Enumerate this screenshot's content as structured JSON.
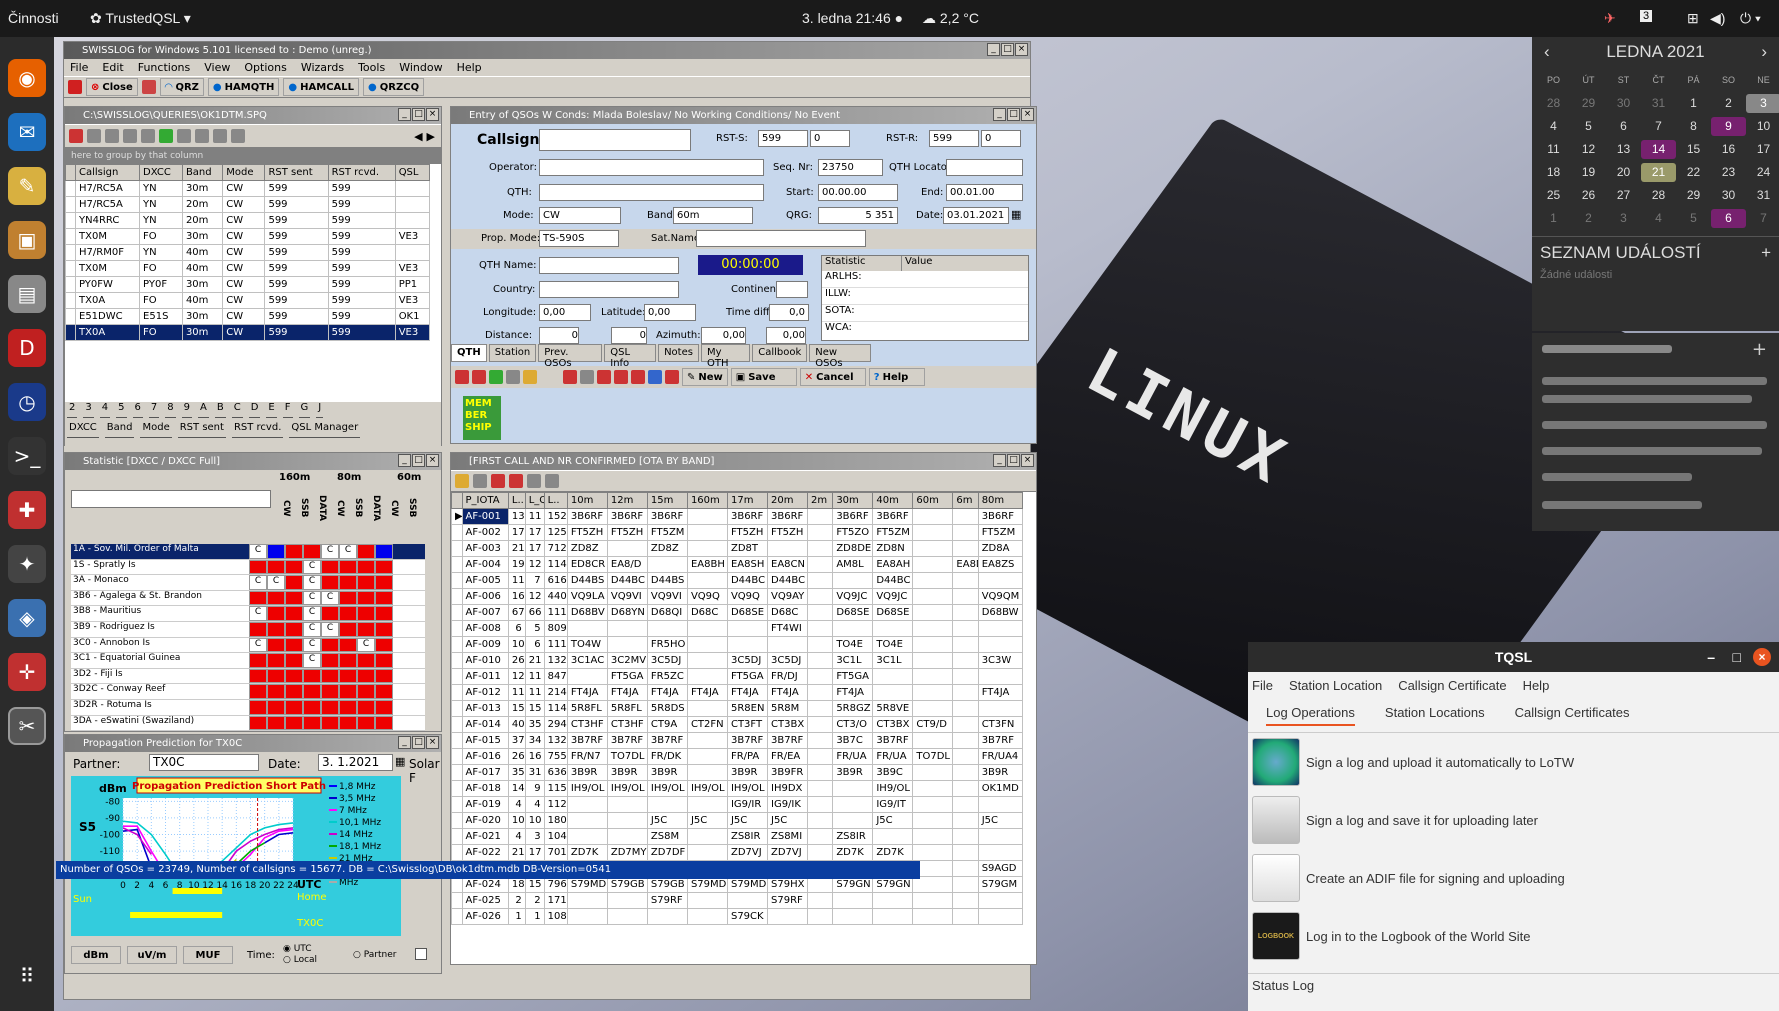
{
  "topbar": {
    "activities": "Činnosti",
    "app": "TrustedQSL",
    "clock": "3. ledna  21:46",
    "weather": "2,2 °C",
    "cal_badge": "3"
  },
  "swisslog": {
    "title": "SWISSLOG for Windows 5.101 licensed to : Demo (unreg.)",
    "menu": [
      "File",
      "Edit",
      "Functions",
      "View",
      "Options",
      "Wizards",
      "Tools",
      "Window",
      "Help"
    ],
    "toolbar": [
      "Close",
      "QRZ",
      "HAMQTH",
      "HAMCALL",
      "QRZCQ"
    ]
  },
  "queries": {
    "title": "C:\\SWISSLOG\\QUERIES\\OK1DTM.SPQ",
    "group_hint": "here to group by that column",
    "columns": [
      "Callsign",
      "DXCC",
      "Band",
      "Mode",
      "RST sent",
      "RST rcvd.",
      "QSL"
    ],
    "rows": [
      [
        "H7/RC5A",
        "YN",
        "30m",
        "CW",
        "599",
        "599",
        ""
      ],
      [
        "H7/RC5A",
        "YN",
        "20m",
        "CW",
        "599",
        "599",
        ""
      ],
      [
        "YN4RRC",
        "YN",
        "20m",
        "CW",
        "599",
        "599",
        ""
      ],
      [
        "TX0M",
        "FO",
        "30m",
        "CW",
        "599",
        "599",
        "VE3"
      ],
      [
        "H7/RM0F",
        "YN",
        "40m",
        "CW",
        "599",
        "599",
        ""
      ],
      [
        "TX0M",
        "FO",
        "40m",
        "CW",
        "599",
        "599",
        "VE3"
      ],
      [
        "PY0FW",
        "PY0F",
        "30m",
        "CW",
        "599",
        "599",
        "PP1"
      ],
      [
        "TX0A",
        "FO",
        "40m",
        "CW",
        "599",
        "599",
        "VE3"
      ],
      [
        "E51DWC",
        "E51S",
        "30m",
        "CW",
        "599",
        "599",
        "OK1"
      ],
      [
        "TX0A",
        "FO",
        "30m",
        "CW",
        "599",
        "599",
        "VE3"
      ]
    ],
    "tabs_top": [
      "2",
      "3",
      "4",
      "5",
      "6",
      "7",
      "8",
      "9",
      "A",
      "B",
      "C",
      "D",
      "E",
      "F",
      "G",
      "J"
    ],
    "tabs_bottom": [
      "DXCC",
      "Band",
      "Mode",
      "RST sent",
      "RST rcvd.",
      "QSL Manager"
    ]
  },
  "entry": {
    "title": "Entry of QSOs   W Conds: Mlada Boleslav/ No Working Conditions/ No Event",
    "labels": {
      "callsign": "Callsign:",
      "rsts": "RST-S:",
      "rstr": "RST-R:",
      "operator": "Operator:",
      "seq": "Seq. Nr:",
      "loc": "QTH Locator:",
      "qth": "QTH:",
      "start": "Start:",
      "end": "End:",
      "mode": "Mode:",
      "band": "Band:",
      "qrg": "QRG:",
      "date": "Date:",
      "prop": "Prop. Mode:",
      "sat": "Sat.Name:",
      "qthname": "QTH Name:",
      "country": "Country:",
      "continent": "Continent:",
      "lon": "Longitude:",
      "lat": "Latitude:",
      "timediff": "Time diff:",
      "distance": "Distance:",
      "azimuth": "Azimuth:"
    },
    "values": {
      "rsts": "599",
      "rsts2": "0",
      "rstr": "599",
      "rstr2": "0",
      "seq": "23750",
      "start": "00.00.00",
      "end": "00.01.00",
      "mode": "CW",
      "band": "60m",
      "qrg": "5 351",
      "date": "03.01.2021",
      "prop": "TS-590S",
      "timer": "00:00:00",
      "lon": "0,00",
      "lat": "0,00",
      "timediff": "0,0",
      "distance": "0",
      "lp": "0",
      "azimuth": "0,00",
      "lp2": "0,00"
    },
    "stat_headers": [
      "Statistic",
      "Value"
    ],
    "stats": [
      "ARLHS:",
      "ILLW:",
      "SOTA:",
      "WCA:"
    ],
    "tabs": [
      "QTH",
      "Station",
      "Prev. QSOs",
      "QSL Info",
      "Notes",
      "My QTH",
      "Callbook",
      "New QSOs"
    ],
    "buttons": [
      "New",
      "Save",
      "Cancel",
      "Help"
    ],
    "member": "MEM BER SHIP"
  },
  "statistic": {
    "title": "Statistic [DXCC / DXCC Full]",
    "bands": [
      "160m",
      "80m",
      "60m"
    ],
    "modes": [
      "CW",
      "SSB",
      "DATA",
      "CW",
      "SSB",
      "DATA",
      "CW",
      "SSB"
    ],
    "rows": [
      "1A - Sov. Mil. Order of Malta",
      "1S - Spratly Is",
      "3A - Monaco",
      "3B6 - Agalega & St. Brandon",
      "3B8 - Mauritius",
      "3B9 - Rodriguez Is",
      "3C0 - Annobon Is",
      "3C1 - Equatorial Guinea",
      "3D2 - Fiji Is",
      "3D2C - Conway Reef",
      "3D2R - Rotuma Is",
      "3DA - eSwatini (Swaziland)"
    ]
  },
  "propagation": {
    "title": "Propagation Prediction for  TX0C",
    "partner_label": "Partner:",
    "partner": "TX0C",
    "date_label": "Date:",
    "date": "3. 1.2021",
    "solar": "Solar F",
    "chart_title": "Propagation Prediction Short Path",
    "units": "dBm",
    "s5": "S5",
    "s1": "S1",
    "sun": "Sun",
    "utc": "UTC",
    "home": "Home",
    "station": "TX0C",
    "buttons": [
      "dBm",
      "uV/m",
      "MUF"
    ],
    "time_label": "Time:",
    "time_opts": [
      "UTC",
      "Local",
      "Partner"
    ],
    "chart_data": {
      "type": "line",
      "ylabel": "dBm",
      "yticks": [
        -80,
        -90,
        -100,
        -110,
        -120
      ],
      "ylim": [
        -125,
        -78
      ],
      "x": [
        0,
        2,
        4,
        6,
        8,
        10,
        12,
        14,
        16,
        18,
        20,
        22,
        24
      ],
      "xlabel": "UTC",
      "series": [
        {
          "name": "1,8 MHz",
          "color": "#0000ff",
          "values": [
            null,
            null,
            null,
            null,
            null,
            null,
            null,
            null,
            null,
            null,
            null,
            null,
            null
          ]
        },
        {
          "name": "3,5 MHz",
          "color": "#0000cc",
          "values": [
            -98,
            -97,
            -120,
            null,
            null,
            null,
            null,
            null,
            null,
            null,
            -105,
            -100,
            -99
          ]
        },
        {
          "name": "7 MHz",
          "color": "#ff00ff",
          "values": [
            -95,
            -95,
            -110,
            -124,
            null,
            null,
            null,
            null,
            -120,
            -112,
            -102,
            -98,
            -97
          ]
        },
        {
          "name": "10,1 MHz",
          "color": "#00cccc",
          "values": [
            -92,
            -93,
            -100,
            -112,
            -125,
            null,
            -124,
            -116,
            -108,
            -100,
            -96,
            -94,
            -93
          ]
        },
        {
          "name": "14 MHz",
          "color": "#cc00cc",
          "values": [
            -96,
            -100,
            -112,
            null,
            null,
            null,
            null,
            -122,
            -110,
            -104,
            -100,
            -97,
            -96
          ]
        },
        {
          "name": "18,1 MHz",
          "color": "#00aa00",
          "values": [
            null,
            null,
            null,
            null,
            null,
            null,
            null,
            null,
            -118,
            -110,
            -105,
            null,
            null
          ]
        },
        {
          "name": "21 MHz",
          "color": "#cccc00",
          "values": [
            null,
            null,
            null,
            null,
            null,
            null,
            null,
            -124,
            -115,
            null,
            null,
            null,
            null
          ]
        },
        {
          "name": "MHz",
          "color": "#8888ff",
          "values": [
            null,
            null,
            null,
            null,
            null,
            null,
            null,
            null,
            null,
            null,
            null,
            null,
            null
          ]
        },
        {
          "name": "MHz",
          "color": "#aaaaaa",
          "values": [
            null,
            null,
            null,
            null,
            null,
            null,
            null,
            null,
            null,
            null,
            null,
            null,
            null
          ]
        }
      ]
    }
  },
  "iota": {
    "title": "[FIRST CALL AND NR CONFIRMED [OTA BY BAND]",
    "columns": [
      "P_IOTA",
      "L..",
      "L_Q...",
      "L..",
      "10m",
      "12m",
      "15m",
      "160m",
      "17m",
      "20m",
      "2m",
      "30m",
      "40m",
      "60m",
      "6m",
      "80m"
    ],
    "rows": [
      [
        "AF-001",
        "13",
        "11",
        "152",
        "3B6RF",
        "3B6RF",
        "3B6RF",
        "",
        "3B6RF",
        "3B6RF",
        "",
        "3B6RF",
        "3B6RF",
        "",
        "",
        "3B6RF"
      ],
      [
        "AF-002",
        "17",
        "17",
        "125",
        "FT5ZH",
        "FT5ZH",
        "FT5ZM",
        "",
        "FT5ZH",
        "FT5ZH",
        "",
        "FT5ZO",
        "FT5ZM",
        "",
        "",
        "FT5ZM"
      ],
      [
        "AF-003",
        "21",
        "17",
        "712",
        "ZD8Z",
        "",
        "ZD8Z",
        "",
        "ZD8T",
        "",
        "",
        "ZD8DE",
        "ZD8N",
        "",
        "",
        "ZD8A"
      ],
      [
        "AF-004",
        "19",
        "12",
        "114",
        "ED8CR",
        "EA8/D",
        "",
        "EA8BH",
        "EA8SH",
        "EA8CN",
        "",
        "AM8L",
        "EA8AH",
        "",
        "EA8DE",
        "EA8ZS"
      ],
      [
        "AF-005",
        "11",
        "7",
        "616",
        "D44BS",
        "D44BC",
        "D44BS",
        "",
        "D44BC",
        "D44BC",
        "",
        "",
        "D44BC",
        "",
        "",
        ""
      ],
      [
        "AF-006",
        "16",
        "12",
        "440",
        "VQ9LA",
        "VQ9VI",
        "VQ9VI",
        "VQ9Q",
        "VQ9Q",
        "VQ9AY",
        "",
        "VQ9JC",
        "VQ9JC",
        "",
        "",
        "VQ9QM"
      ],
      [
        "AF-007",
        "67",
        "66",
        "111",
        "D68BV",
        "D68YN",
        "D68QI",
        "D68C",
        "D68SE",
        "D68C",
        "",
        "D68SE",
        "D68SE",
        "",
        "",
        "D68BW"
      ],
      [
        "AF-008",
        "6",
        "5",
        "809",
        "",
        "",
        "",
        "",
        "",
        "FT4WI",
        "",
        "",
        "",
        "",
        "",
        ""
      ],
      [
        "AF-009",
        "10",
        "6",
        "111",
        "TO4W",
        "",
        "FR5HO",
        "",
        "",
        "",
        "",
        "TO4E",
        "TO4E",
        "",
        "",
        ""
      ],
      [
        "AF-010",
        "26",
        "21",
        "132",
        "3C1AC",
        "3C2MV",
        "3C5DJ",
        "",
        "3C5DJ",
        "3C5DJ",
        "",
        "3C1L",
        "3C1L",
        "",
        "",
        "3C3W"
      ],
      [
        "AF-011",
        "12",
        "11",
        "847",
        "",
        "FT5GA",
        "FR5ZC",
        "",
        "FT5GA",
        "FR/DJ",
        "",
        "FT5GA",
        "",
        "",
        "",
        ""
      ],
      [
        "AF-012",
        "11",
        "11",
        "214",
        "FT4JA",
        "FT4JA",
        "FT4JA",
        "FT4JA",
        "FT4JA",
        "FT4JA",
        "",
        "FT4JA",
        "",
        "",
        "",
        "FT4JA"
      ],
      [
        "AF-013",
        "15",
        "15",
        "114",
        "5R8FL",
        "5R8FL",
        "5R8DS",
        "",
        "5R8EN",
        "5R8M",
        "",
        "5R8GZ",
        "5R8VE",
        "",
        "",
        ""
      ],
      [
        "AF-014",
        "40",
        "35",
        "294",
        "CT3HF",
        "CT3HF",
        "CT9A",
        "CT2FN",
        "CT3FT",
        "CT3BX",
        "",
        "CT3/O",
        "CT3BX",
        "CT9/D",
        "",
        "CT3FN"
      ],
      [
        "AF-015",
        "37",
        "34",
        "132",
        "3B7RF",
        "3B7RF",
        "3B7RF",
        "",
        "3B7RF",
        "3B7RF",
        "",
        "3B7C",
        "3B7RF",
        "",
        "",
        "3B7RF"
      ],
      [
        "AF-016",
        "26",
        "16",
        "755",
        "FR/N7",
        "TO7DL",
        "FR/DK",
        "",
        "FR/PA",
        "FR/EA",
        "",
        "FR/UA",
        "FR/UA",
        "TO7DL",
        "",
        "FR/UA4"
      ],
      [
        "AF-017",
        "35",
        "31",
        "636",
        "3B9R",
        "3B9R",
        "3B9R",
        "",
        "3B9R",
        "3B9FR",
        "",
        "3B9R",
        "3B9C",
        "",
        "",
        "3B9R"
      ],
      [
        "AF-018",
        "14",
        "9",
        "115",
        "IH9/OL",
        "IH9/OL",
        "IH9/OL",
        "IH9/OL",
        "IH9/OL",
        "IH9DX",
        "",
        "",
        "IH9/OL",
        "",
        "",
        "OK1MD"
      ],
      [
        "AF-019",
        "4",
        "4",
        "112",
        "",
        "",
        "",
        "",
        "IG9/IR",
        "IG9/IK",
        "",
        "",
        "IG9/IT",
        "",
        "",
        ""
      ],
      [
        "AF-020",
        "10",
        "10",
        "180",
        "",
        "",
        "J5C",
        "J5C",
        "J5C",
        "J5C",
        "",
        "",
        "J5C",
        "",
        "",
        "J5C"
      ],
      [
        "AF-021",
        "4",
        "3",
        "104",
        "",
        "",
        "ZS8M",
        "",
        "ZS8IR",
        "ZS8MI",
        "",
        "ZS8IR",
        "",
        "",
        "",
        ""
      ],
      [
        "AF-022",
        "21",
        "17",
        "701",
        "ZD7K",
        "ZD7MY",
        "ZD7DF",
        "",
        "ZD7VJ",
        "ZD7VJ",
        "",
        "ZD7K",
        "ZD7K",
        "",
        "",
        ""
      ],
      [
        "AF-023",
        "46",
        "40",
        "684",
        "S92SS",
        "S9LA",
        "S92SS",
        "S92SS",
        "S92SS",
        "S92LB",
        "",
        "S92SS",
        "S92YN",
        "",
        "",
        "S9AGD"
      ],
      [
        "AF-024",
        "18",
        "15",
        "796",
        "S79MD",
        "S79GB",
        "S79GB",
        "S79MD",
        "S79MD",
        "S79HX",
        "",
        "S79GN",
        "S79GN",
        "",
        "",
        "S79GM"
      ],
      [
        "AF-025",
        "2",
        "2",
        "171",
        "",
        "",
        "S79RF",
        "",
        "",
        "S79RF",
        "",
        "",
        "",
        "",
        "",
        ""
      ],
      [
        "AF-026",
        "1",
        "1",
        "108",
        "",
        "",
        "",
        "",
        "S79CK",
        "",
        "",
        "",
        "",
        "",
        "",
        ""
      ]
    ]
  },
  "status": "Number of QSOs = 23749, Number of callsigns = 15677. DB = C:\\Swisslog\\DB\\ok1dtm.mdb DB-Version=0541",
  "calendar": {
    "month": "LEDNA 2021",
    "days": [
      "PO",
      "ÚT",
      "ST",
      "ČT",
      "PÁ",
      "SO",
      "NE"
    ],
    "dates": [
      "28",
      "29",
      "30",
      "31",
      "1",
      "2",
      "3",
      "4",
      "5",
      "6",
      "7",
      "8",
      "9",
      "10",
      "11",
      "12",
      "13",
      "14",
      "15",
      "16",
      "17",
      "18",
      "19",
      "20",
      "21",
      "22",
      "23",
      "24",
      "25",
      "26",
      "27",
      "28",
      "29",
      "30",
      "31",
      "1",
      "2",
      "3",
      "4",
      "5",
      "6",
      "7"
    ],
    "events_title": "SEZNAM UDÁLOSTÍ",
    "no_events": "Žádné události"
  },
  "tqsl": {
    "title": "TQSL",
    "menu": [
      "File",
      "Station Location",
      "Callsign Certificate",
      "Help"
    ],
    "tabs": [
      "Log Operations",
      "Station Locations",
      "Callsign Certificates"
    ],
    "actions": [
      "Sign a log and upload it automatically to LoTW",
      "Sign a log and save it for uploading later",
      "Create an ADIF file for signing and uploading",
      "Log in to the Logbook of the World Site"
    ],
    "status_log": "Status Log",
    "logbook_icon": "LOGBOOK"
  }
}
